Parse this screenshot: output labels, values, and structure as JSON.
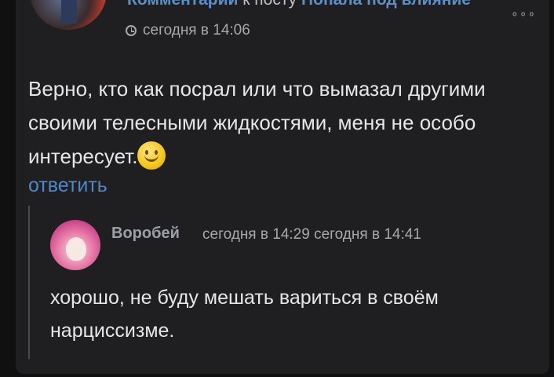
{
  "parent_comment": {
    "header_link": "Комментарий",
    "header_connector": " к посту ",
    "post_title": "Попала под влияние",
    "more_icon": "more-dots-icon",
    "time": "сегодня в 14:06",
    "text": "Верно, кто как посрал или что вымазал другими своими телесными жидкостями, меня не особо интересует.",
    "reply_label": "ответить"
  },
  "reply_comment": {
    "author": "Воробей",
    "time_created": "сегодня в 14:29",
    "time_edited": "сегодня в 14:41",
    "text": "хорошо, не буду мешать вариться в своём нарциссизме."
  },
  "colors": {
    "background": "#101010",
    "card": "#1f1f21",
    "link": "#4f89c9",
    "text": "#e6e6e6",
    "muted": "#a8a8a8"
  }
}
